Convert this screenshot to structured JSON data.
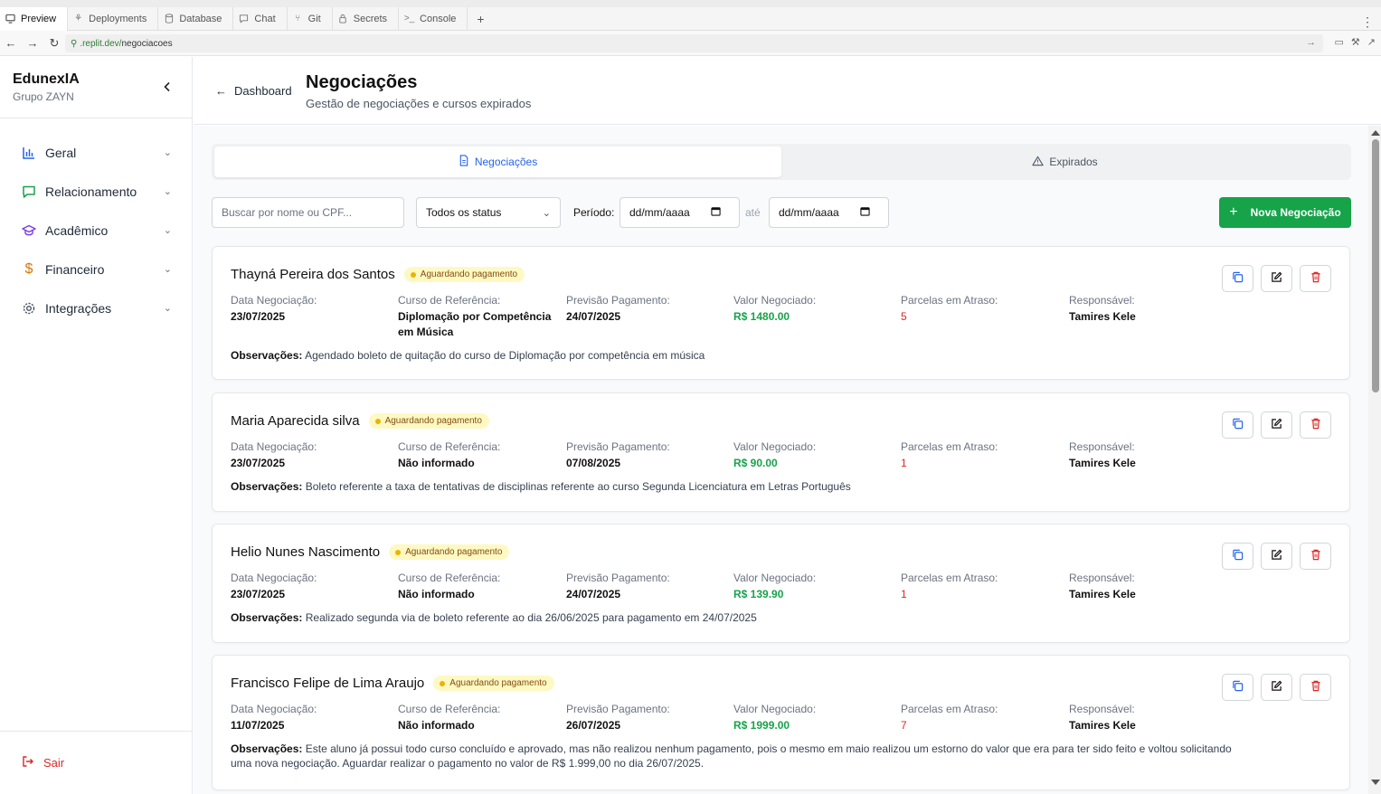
{
  "ide": {
    "tabs": [
      {
        "label": "Preview",
        "icon": "monitor-icon"
      },
      {
        "label": "Deployments",
        "icon": "deploy-icon"
      },
      {
        "label": "Database",
        "icon": "database-icon"
      },
      {
        "label": "Chat",
        "icon": "chat-icon"
      },
      {
        "label": "Git",
        "icon": "git-icon"
      },
      {
        "label": "Secrets",
        "icon": "lock-icon"
      },
      {
        "label": "Console",
        "icon": "terminal-icon"
      }
    ],
    "url_host": ".replit.dev/",
    "url_path": "negociacoes"
  },
  "sidebar": {
    "brand": "EdunexIA",
    "brand_sub": "Grupo ZAYN",
    "items": [
      {
        "label": "Geral",
        "icon": "bar-chart-icon",
        "color": "#2563eb"
      },
      {
        "label": "Relacionamento",
        "icon": "message-icon",
        "color": "#16a34a"
      },
      {
        "label": "Acadêmico",
        "icon": "graduation-cap-icon",
        "color": "#7c3aed"
      },
      {
        "label": "Financeiro",
        "icon": "dollar-icon",
        "color": "#d97706"
      },
      {
        "label": "Integrações",
        "icon": "gear-icon",
        "color": "#4b5563"
      }
    ],
    "logout": "Sair"
  },
  "header": {
    "back": "Dashboard",
    "title": "Negociações",
    "subtitle": "Gestão de negociações e cursos expirados"
  },
  "tabs": {
    "negociacoes": "Negociações",
    "expirados": "Expirados"
  },
  "filters": {
    "search_placeholder": "Buscar por nome ou CPF...",
    "status": "Todos os status",
    "periodo_label": "Período:",
    "date_from": "dd/mm/aaaa",
    "ate_label": "até",
    "date_to": "dd/mm/aaaa",
    "new_button": "Nova Negociação"
  },
  "labels": {
    "data": "Data Negociação:",
    "curso": "Curso de Referência:",
    "previsao": "Previsão Pagamento:",
    "valor": "Valor Negociado:",
    "parcelas": "Parcelas em Atraso:",
    "responsavel": "Responsável:",
    "obs": "Observações:"
  },
  "cards": [
    {
      "name": "Thayná Pereira dos Santos",
      "status": "Aguardando pagamento",
      "data": "23/07/2025",
      "curso": "Diplomação por Competência em Música",
      "previsao": "24/07/2025",
      "valor": "R$ 1480.00",
      "parcelas": "5",
      "responsavel": "Tamires Kele",
      "obs": "Agendado boleto de quitação do curso de Diplomação por competência em música"
    },
    {
      "name": "Maria Aparecida silva",
      "status": "Aguardando pagamento",
      "data": "23/07/2025",
      "curso": "Não informado",
      "previsao": "07/08/2025",
      "valor": "R$ 90.00",
      "parcelas": "1",
      "responsavel": "Tamires Kele",
      "obs": "Boleto referente a taxa de tentativas de disciplinas referente ao curso Segunda Licenciatura em Letras Português"
    },
    {
      "name": "Helio Nunes Nascimento",
      "status": "Aguardando pagamento",
      "data": "23/07/2025",
      "curso": "Não informado",
      "previsao": "24/07/2025",
      "valor": "R$ 139.90",
      "parcelas": "1",
      "responsavel": "Tamires Kele",
      "obs": "Realizado segunda via de boleto referente ao dia 26/06/2025 para pagamento em 24/07/2025"
    },
    {
      "name": "Francisco Felipe de Lima Araujo",
      "status": "Aguardando pagamento",
      "data": "11/07/2025",
      "curso": "Não informado",
      "previsao": "26/07/2025",
      "valor": "R$ 1999.00",
      "parcelas": "7",
      "responsavel": "Tamires Kele",
      "obs": "Este aluno já possui todo curso concluído e aprovado, mas não realizou nenhum pagamento, pois o mesmo em maio realizou um estorno do valor que era para ter sido feito e voltou solicitando uma nova negociação. Aguardar realizar o pagamento no valor de R$ 1.999,00 no dia 26/07/2025."
    }
  ]
}
